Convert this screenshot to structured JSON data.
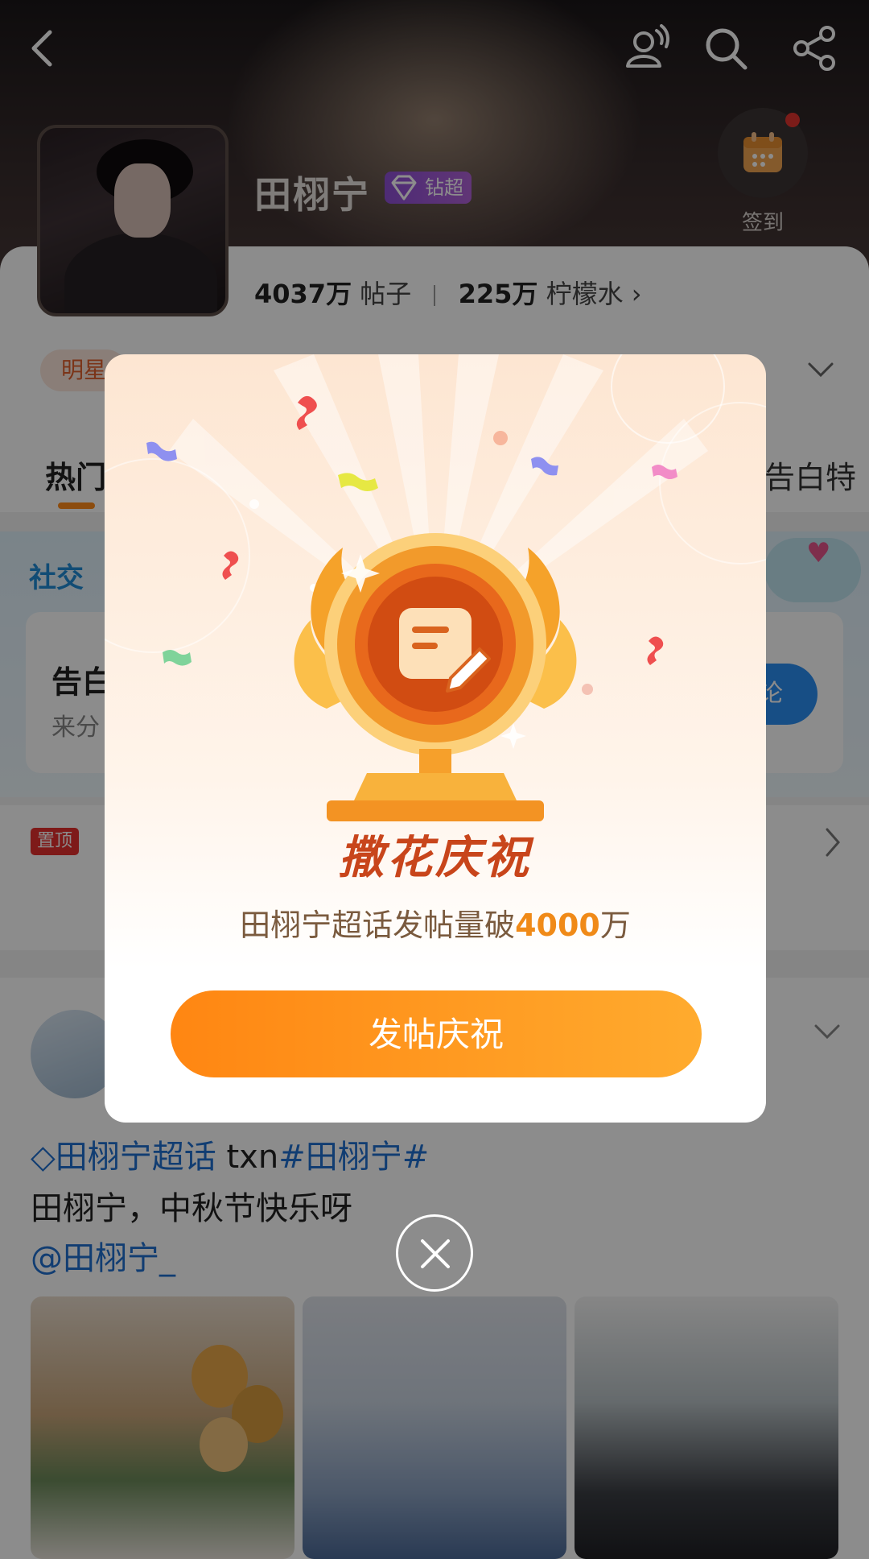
{
  "header": {
    "title": "田栩宁",
    "badge_label": "钻超",
    "signin_label": "签到",
    "stats": {
      "posts_value": "4037万",
      "posts_label": "帖子",
      "water_value": "225万",
      "water_label": "柠檬水 ›"
    }
  },
  "content": {
    "tag_chip": "明星",
    "tab_hot": "热门",
    "tab_right": "告白特",
    "social_title": "社交",
    "confess_title": "告白",
    "confess_sub": "来分",
    "blue_btn": "论",
    "pinned_tag": "置顶",
    "post": {
      "topic": "田栩宁超话",
      "topic_text": " txn",
      "hashtag": "#田栩宁#",
      "line2": "田栩宁，中秋节快乐呀",
      "mention": "@田栩宁_"
    }
  },
  "modal": {
    "title": "撒花庆祝",
    "subtitle_prefix": "田栩宁超话发帖量破",
    "subtitle_number": "4000",
    "subtitle_suffix": "万",
    "button": "发帖庆祝"
  },
  "colors": {
    "accent_orange": "#ff8612",
    "title_red": "#c8451b",
    "link_blue": "#1f6fd0",
    "badge_purple": "#8e4fd6"
  }
}
